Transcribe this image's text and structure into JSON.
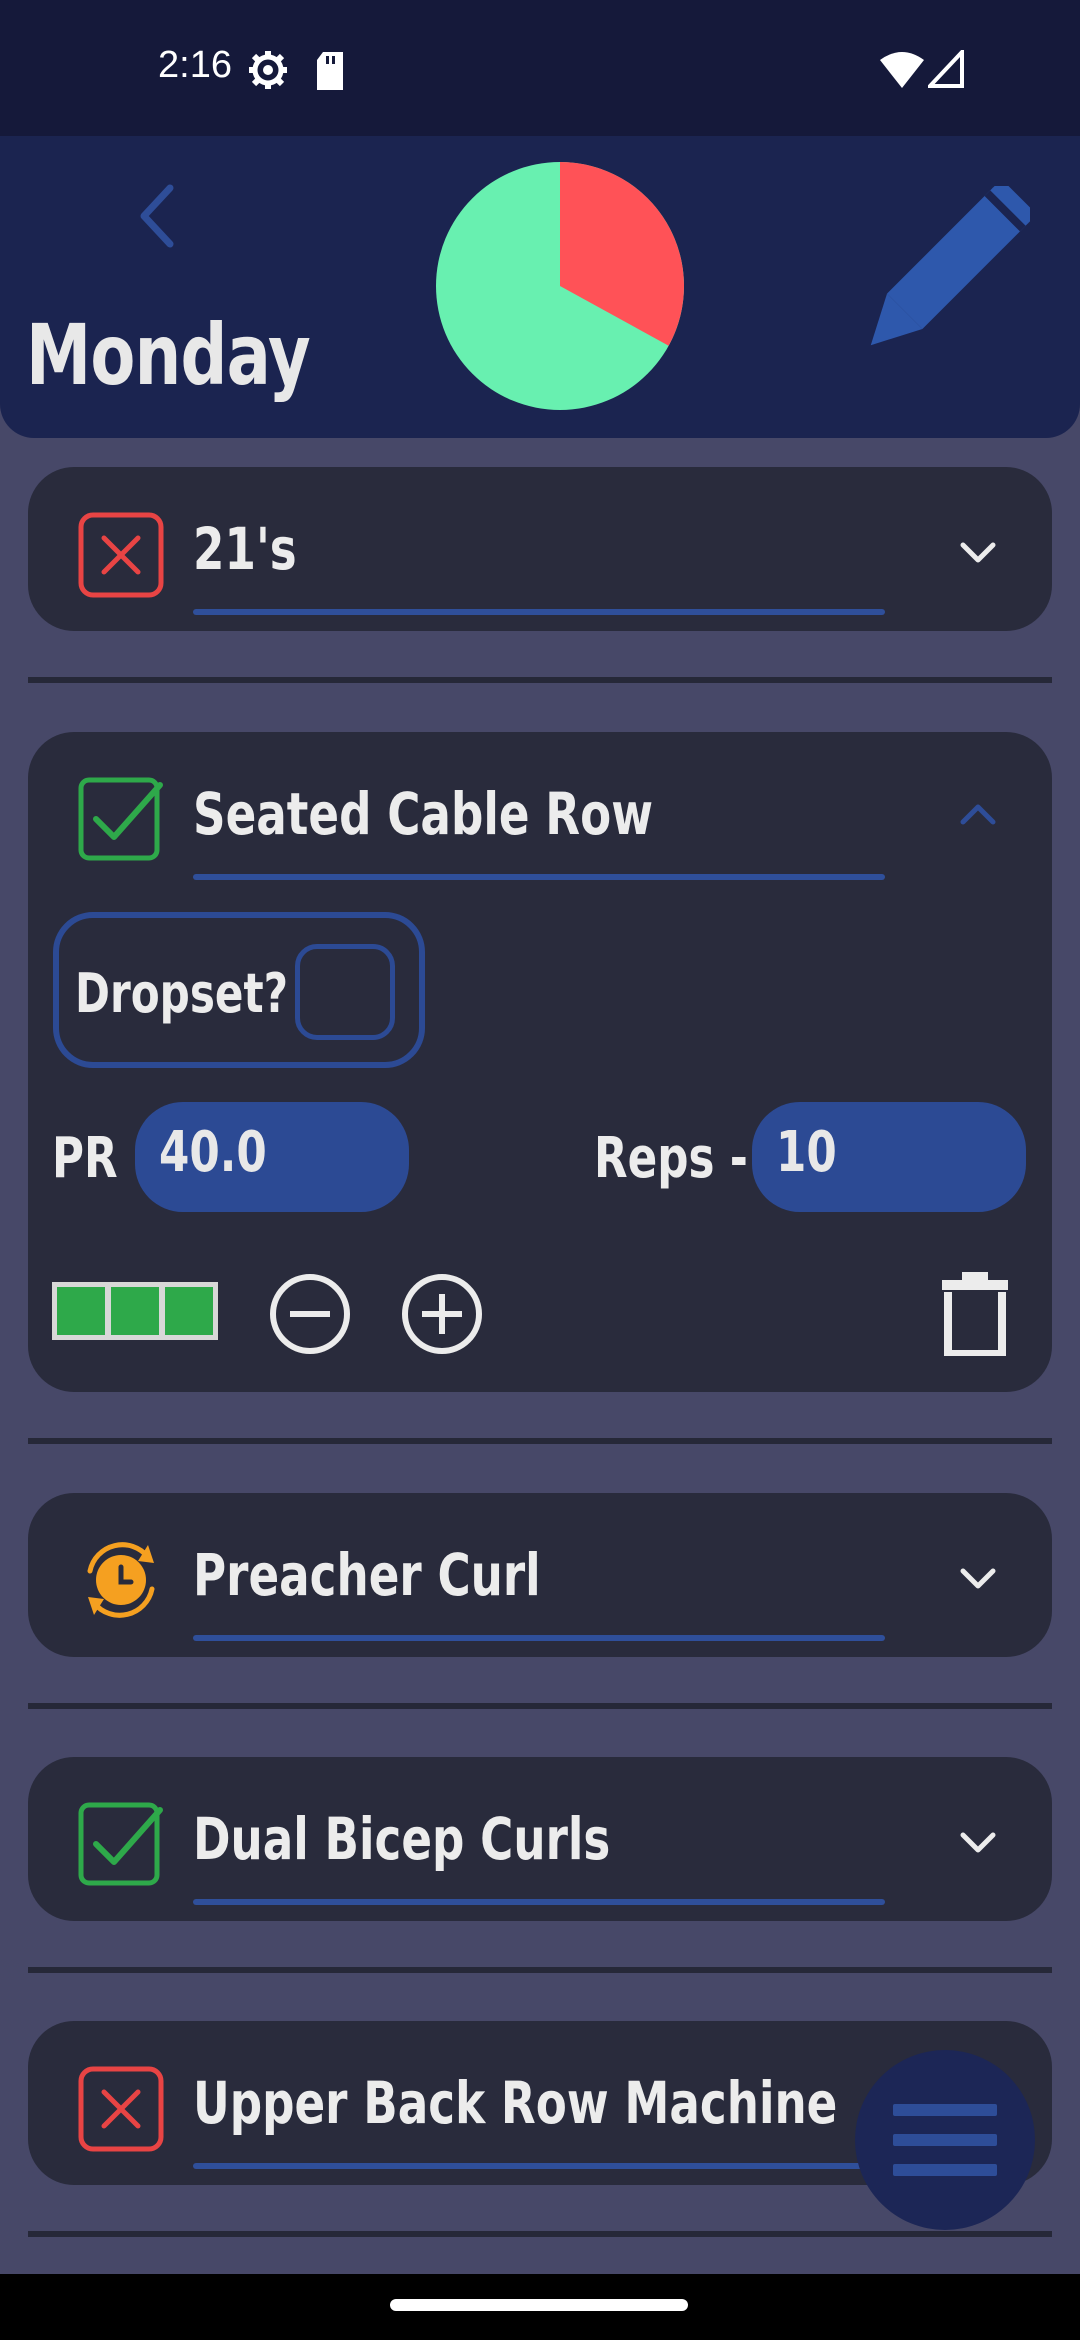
{
  "status_bar": {
    "time": "2:16",
    "icons": [
      "settings-icon",
      "sd-card-icon",
      "wifi-icon",
      "signal-icon"
    ]
  },
  "header": {
    "title": "Monday",
    "progress_pie": {
      "completed_fraction": 0.67,
      "remaining_fraction": 0.33,
      "completed_color": "#68f0b0",
      "remaining_color": "#ff5257"
    },
    "back_icon": "chevron-left-icon",
    "edit_icon": "pencil-icon"
  },
  "colors": {
    "background": "#474868",
    "header": "#1b2450",
    "card": "#292b3c",
    "accent": "#2c4a94",
    "done": "#2ea94a",
    "failed": "#e84444",
    "pending": "#f5a020"
  },
  "exercises": [
    {
      "name": "21's",
      "status": "failed",
      "status_icon": "x-box-icon",
      "expanded": false
    },
    {
      "name": "Seated Cable Row",
      "status": "done",
      "status_icon": "check-box-icon",
      "expanded": true,
      "dropset_label": "Dropset?",
      "dropset_checked": false,
      "pr_label": "PR",
      "pr_value": "40.0",
      "reps_label": "Reps -",
      "reps_value": "10",
      "sets_completed": 3
    },
    {
      "name": "Preacher Curl",
      "status": "pending",
      "status_icon": "timer-sync-icon",
      "expanded": false
    },
    {
      "name": "Dual Bicep Curls",
      "status": "done",
      "status_icon": "check-box-icon",
      "expanded": false
    },
    {
      "name": "Upper Back Row Machine",
      "status": "failed",
      "status_icon": "x-box-icon",
      "expanded": false
    }
  ],
  "fab": {
    "icon": "menu-icon"
  }
}
